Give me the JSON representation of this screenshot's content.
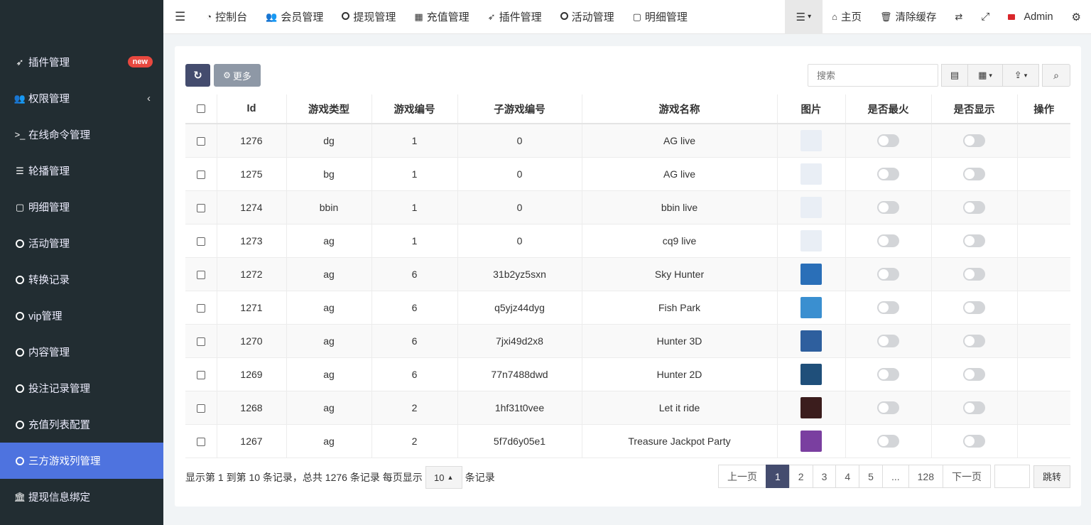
{
  "sidebar": {
    "items": [
      {
        "label": "插件管理",
        "icon": "rocket-icon",
        "badge": "new"
      },
      {
        "label": "权限管理",
        "icon": "users-icon",
        "arrow": "‹"
      },
      {
        "label": "在线命令管理",
        "icon": "terminal-icon"
      },
      {
        "label": "轮播管理",
        "icon": "bars-icon"
      },
      {
        "label": "明细管理",
        "icon": "calendar-icon"
      },
      {
        "label": "活动管理",
        "icon": "circle-icon"
      },
      {
        "label": "转换记录",
        "icon": "circle-icon"
      },
      {
        "label": "vip管理",
        "icon": "circle-icon"
      },
      {
        "label": "内容管理",
        "icon": "circle-icon"
      },
      {
        "label": "投注记录管理",
        "icon": "circle-icon"
      },
      {
        "label": "充值列表配置",
        "icon": "circle-icon"
      },
      {
        "label": "三方游戏列管理",
        "icon": "circle-icon",
        "active": true
      },
      {
        "label": "提现信息绑定",
        "icon": "bank-icon"
      }
    ]
  },
  "topnav": {
    "items": [
      {
        "label": "控制台",
        "icon": "dashboard-icon"
      },
      {
        "label": "会员管理",
        "icon": "users-icon"
      },
      {
        "label": "提现管理",
        "icon": "circle-icon"
      },
      {
        "label": "充值管理",
        "icon": "grid-icon"
      },
      {
        "label": "插件管理",
        "icon": "rocket-icon"
      },
      {
        "label": "活动管理",
        "icon": "circle-icon"
      },
      {
        "label": "明细管理",
        "icon": "calendar-icon"
      }
    ],
    "home": "主页",
    "clear_cache": "清除缓存",
    "user": "Admin"
  },
  "toolbar": {
    "more_label": "更多",
    "search_placeholder": "搜索"
  },
  "table": {
    "headers": [
      "Id",
      "游戏类型",
      "游戏编号",
      "子游戏编号",
      "游戏名称",
      "图片",
      "是否最火",
      "是否显示",
      "操作"
    ],
    "rows": [
      {
        "id": "1276",
        "type": "dg",
        "game_no": "1",
        "sub_no": "0",
        "name": "AG live",
        "thumb": "#e9eef5"
      },
      {
        "id": "1275",
        "type": "bg",
        "game_no": "1",
        "sub_no": "0",
        "name": "AG live",
        "thumb": "#e9eef5"
      },
      {
        "id": "1274",
        "type": "bbin",
        "game_no": "1",
        "sub_no": "0",
        "name": "bbin live",
        "thumb": "#e9eef5"
      },
      {
        "id": "1273",
        "type": "ag",
        "game_no": "1",
        "sub_no": "0",
        "name": "cq9 live",
        "thumb": "#e9eef5"
      },
      {
        "id": "1272",
        "type": "ag",
        "game_no": "6",
        "sub_no": "31b2yz5sxn",
        "name": "Sky Hunter",
        "thumb": "#2a6fb8"
      },
      {
        "id": "1271",
        "type": "ag",
        "game_no": "6",
        "sub_no": "q5yjz44dyg",
        "name": "Fish Park",
        "thumb": "#3a8fd0"
      },
      {
        "id": "1270",
        "type": "ag",
        "game_no": "6",
        "sub_no": "7jxi49d2x8",
        "name": "Hunter 3D",
        "thumb": "#2e5f9e"
      },
      {
        "id": "1269",
        "type": "ag",
        "game_no": "6",
        "sub_no": "77n7488dwd",
        "name": "Hunter 2D",
        "thumb": "#1f4f7a"
      },
      {
        "id": "1268",
        "type": "ag",
        "game_no": "2",
        "sub_no": "1hf31t0vee",
        "name": "Let it ride",
        "thumb": "#3b1d1d"
      },
      {
        "id": "1267",
        "type": "ag",
        "game_no": "2",
        "sub_no": "5f7d6y05e1",
        "name": "Treasure Jackpot Party",
        "thumb": "#7a3fa0"
      }
    ]
  },
  "footer": {
    "info_text": "显示第 1 到第 10 条记录，总共 1276 条记录 每页显示",
    "page_size": "10",
    "suffix": "条记录",
    "prev": "上一页",
    "pages": [
      "1",
      "2",
      "3",
      "4",
      "5",
      "...",
      "128"
    ],
    "next": "下一页",
    "jump": "跳转"
  }
}
